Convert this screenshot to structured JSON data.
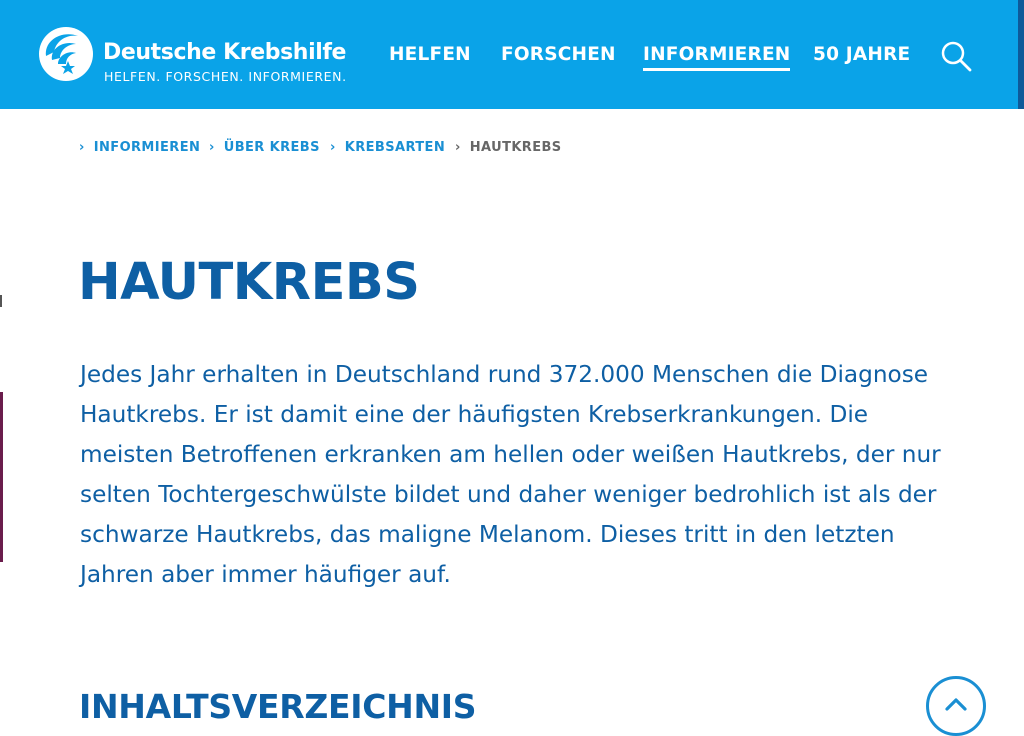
{
  "brand": {
    "name": "Deutsche Krebshilfe",
    "tagline": "HELFEN. FORSCHEN. INFORMIEREN."
  },
  "nav": {
    "items": [
      {
        "label": "HELFEN",
        "active": false
      },
      {
        "label": "FORSCHEN",
        "active": false
      },
      {
        "label": "INFORMIEREN",
        "active": true
      },
      {
        "label": "50 JAHRE",
        "active": false
      }
    ],
    "search_icon": "search-icon"
  },
  "breadcrumb": {
    "items": [
      {
        "label": "INFORMIEREN",
        "current": false
      },
      {
        "label": "ÜBER KREBS",
        "current": false
      },
      {
        "label": "KREBSARTEN",
        "current": false
      },
      {
        "label": "HAUTKREBS",
        "current": true
      }
    ],
    "separator": "›"
  },
  "main": {
    "title": "HAUTKREBS",
    "intro": "Jedes Jahr erhalten in Deutschland rund 372.000 Menschen die Diagnose\nHautkrebs. Er ist damit eine der häufigsten Krebserkrankungen. Die\nmeisten Betroffenen erkranken am hellen oder weißen Hautkrebs, der nur\nselten Tochtergeschwülste bildet und daher weniger bedrohlich ist als der\nschwarze Hautkrebs, das maligne Melanom. Dieses tritt in den letzten\nJahren aber immer häufiger auf.",
    "toc_title": "INHALTSVERZEICHNIS"
  },
  "scroll_top_icon": "chevron-up-icon",
  "colors": {
    "header": "#0aa3e8",
    "header_edge": "#0e5a99",
    "heading": "#0e5fa4",
    "link": "#1a8fd3",
    "breadcrumb_current": "#676767"
  }
}
